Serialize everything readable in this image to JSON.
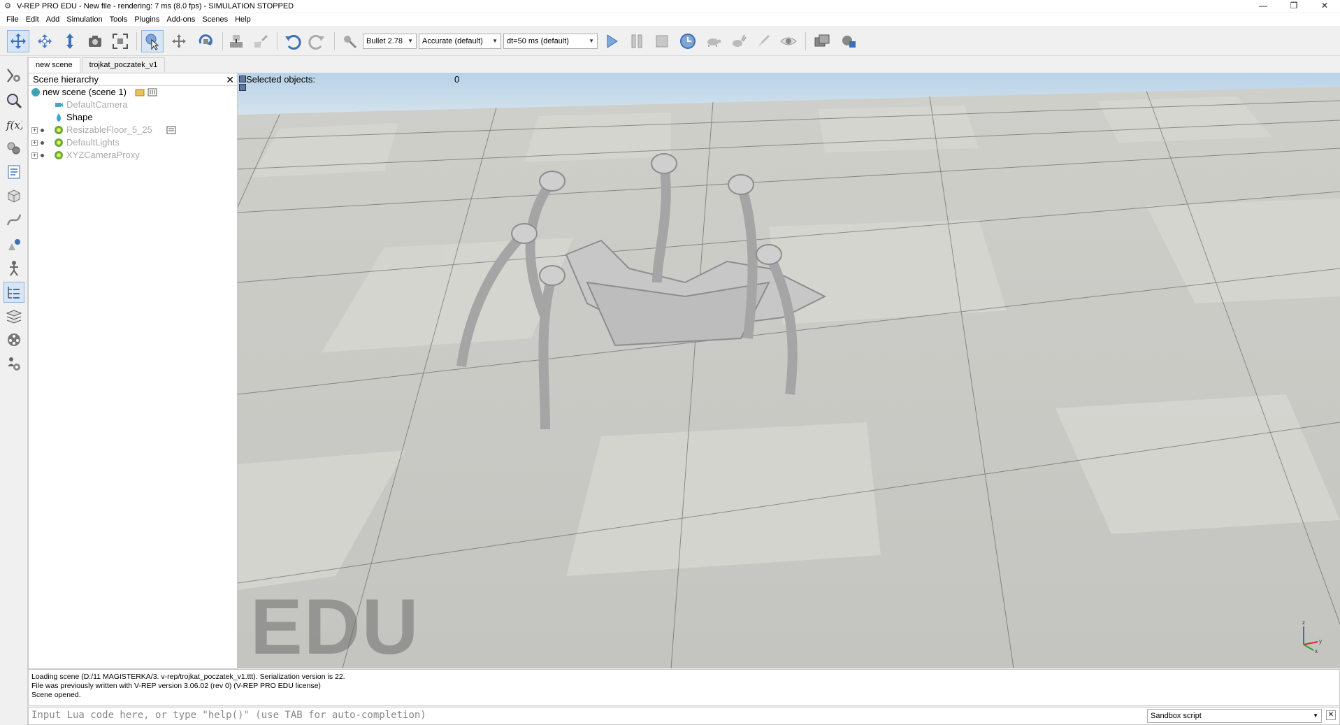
{
  "window": {
    "title": "V-REP PRO EDU - New file - rendering: 7 ms (8.0 fps) - SIMULATION STOPPED",
    "minimize_label": "—",
    "restore_label": "❐",
    "close_label": "✕"
  },
  "menu": [
    "File",
    "Edit",
    "Add",
    "Simulation",
    "Tools",
    "Plugins",
    "Add-ons",
    "Scenes",
    "Help"
  ],
  "toolbar": {
    "physics_engine": "Bullet 2.78",
    "accuracy": "Accurate (default)",
    "timestep": "dt=50 ms (default)"
  },
  "tabs": [
    {
      "label": "new scene",
      "active": true
    },
    {
      "label": "trojkat_poczatek_v1",
      "active": false
    }
  ],
  "hierarchy": {
    "title": "Scene hierarchy",
    "close": "✕",
    "items": [
      {
        "label": "new scene (scene 1)"
      },
      {
        "label": "DefaultCamera"
      },
      {
        "label": "Shape"
      },
      {
        "label": "ResizableFloor_5_25"
      },
      {
        "label": "DefaultLights"
      },
      {
        "label": "XYZCameraProxy"
      }
    ],
    "expander": "+"
  },
  "viewport": {
    "selected_label": "Selected objects:",
    "selected_count": "0",
    "watermark": "EDU",
    "axis_z": "z",
    "axis_y": "y",
    "axis_x": "x"
  },
  "console": {
    "lines": [
      "Loading scene (D:/11 MAGISTERKA/3. v-rep/trojkat_poczatek_v1.ttt).  Serialization version is 22.",
      "File was previously written with V-REP version 3.06.02 (rev 0) (V-REP PRO EDU license)",
      "Scene opened."
    ]
  },
  "lua": {
    "placeholder": "Input Lua code here, or type \"help()\" (use TAB for auto-completion)",
    "script_type": "Sandbox script",
    "close": "✕"
  },
  "colors": {
    "accent": "#3b6fb6",
    "floor_light": "#d9d9d4",
    "floor_dark": "#c2c3bf",
    "robot": "#a9a9a9",
    "sky": "#cfe0ee"
  }
}
